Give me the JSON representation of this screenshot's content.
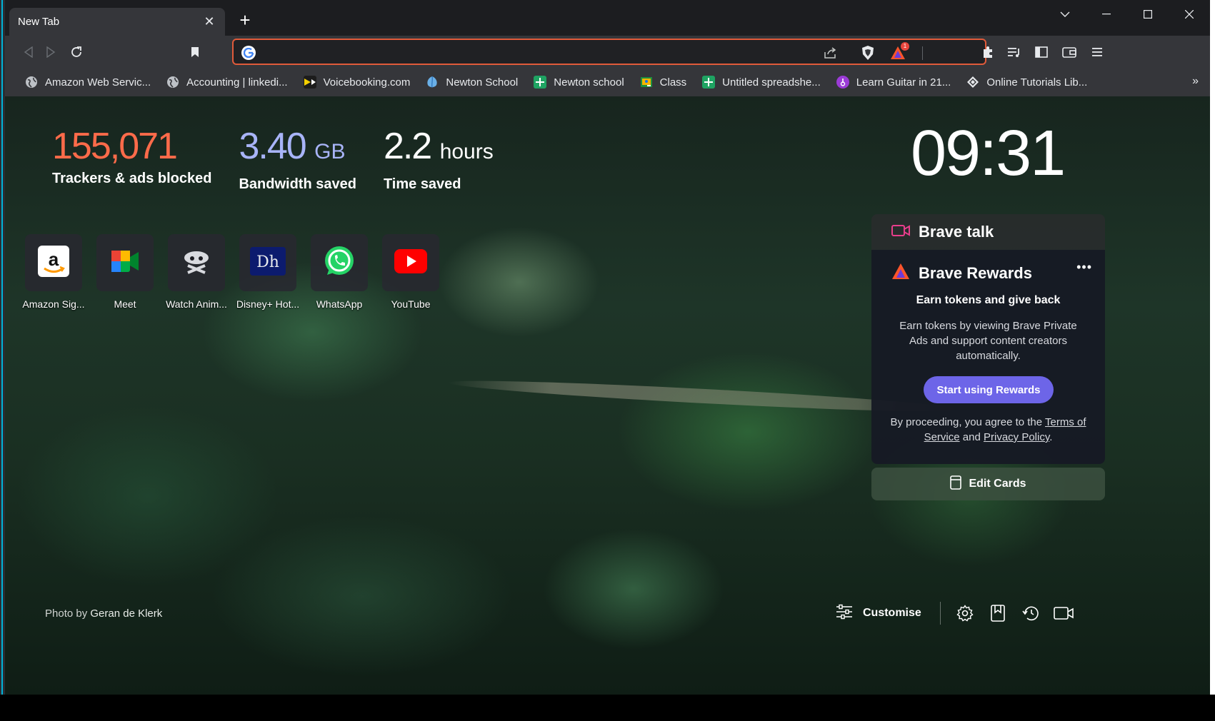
{
  "tab": {
    "title": "New Tab"
  },
  "window": {
    "minimize": "—",
    "maximize": "☐",
    "close": "✕",
    "tab_list": "⌄"
  },
  "omnibox": {
    "value": "",
    "placeholder": "",
    "rewards_count": "1"
  },
  "bookmarks": [
    {
      "label": "Amazon Web Servic...",
      "icon": "globe-icon",
      "color": "#e8eaed"
    },
    {
      "label": "Accounting | linkedi...",
      "icon": "globe-icon",
      "color": "#e8eaed"
    },
    {
      "label": "Voicebooking.com",
      "icon": "voicebooking-icon",
      "color": "#f5d000"
    },
    {
      "label": "Newton School",
      "icon": "newton-icon",
      "color": "#6ab0e8"
    },
    {
      "label": "Newton school",
      "icon": "sheets-icon",
      "color": "#1ea362"
    },
    {
      "label": "Class",
      "icon": "classroom-icon",
      "color": "#f4b400"
    },
    {
      "label": "Untitled spreadshe...",
      "icon": "sheets-icon",
      "color": "#1ea362"
    },
    {
      "label": "Learn Guitar in 21...",
      "icon": "guitar-icon",
      "color": "#9b3bd6"
    },
    {
      "label": "Online Tutorials Lib...",
      "icon": "tutorials-icon",
      "color": "#e8eaed"
    }
  ],
  "stats": {
    "trackers": {
      "value": "155,071",
      "label": "Trackers & ads blocked",
      "color": "#ff6b4a"
    },
    "bandwidth": {
      "value": "3.40",
      "unit": "GB",
      "label": "Bandwidth saved",
      "color": "#a8b4f8"
    },
    "time": {
      "value": "2.2",
      "unit": "hours",
      "label": "Time saved",
      "color": "#ffffff"
    }
  },
  "clock": "09:31",
  "tiles": [
    {
      "label": "Amazon Sig...",
      "icon": "amazon-icon"
    },
    {
      "label": "Meet",
      "icon": "google-meet-icon"
    },
    {
      "label": "Watch Anim...",
      "icon": "anime-icon"
    },
    {
      "label": "Disney+ Hot...",
      "icon": "disney-hotstar-icon"
    },
    {
      "label": "WhatsApp",
      "icon": "whatsapp-icon"
    },
    {
      "label": "YouTube",
      "icon": "youtube-icon"
    }
  ],
  "talk": {
    "title": "Brave talk"
  },
  "rewards": {
    "title": "Brave Rewards",
    "more": "•••",
    "subtitle": "Earn tokens and give back",
    "description": "Earn tokens by viewing Brave Private Ads and support content creators automatically.",
    "button": "Start using Rewards",
    "legal_prefix": "By proceeding, you agree to the ",
    "terms": "Terms of Service",
    "and": " and ",
    "privacy": "Privacy Policy",
    "period": "."
  },
  "edit_cards": "Edit Cards",
  "credit": {
    "prefix": "Photo by ",
    "author": "Geran de Klerk"
  },
  "customise": "Customise"
}
